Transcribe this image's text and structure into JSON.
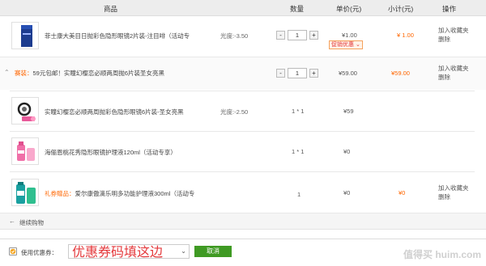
{
  "header": {
    "goods": "商品",
    "quantity": "数量",
    "unit_price": "单价(元)",
    "subtotal": "小计(元)",
    "operation": "操作"
  },
  "rows": [
    {
      "name": "菲士康大美目日抛彩色隐形眼镜2片装-注目啡（活动专",
      "spec": "光度:-3.50",
      "qty": "1",
      "price": "¥1.00",
      "promo": "促销优惠",
      "subtotal": "1.00",
      "op1": "加入收藏夹",
      "op2": "删除"
    }
  ],
  "bundle": {
    "tag": "赛装：",
    "title": "59元包邮！实瞳幻樱恋必顺两周抛6片装圣女亮黑",
    "qty": "1",
    "price": "¥59.00",
    "subtotal": "¥59.00",
    "op1": "加入收藏夹",
    "op2": "删除",
    "items": [
      {
        "name": "实瞳幻樱恋必顺两周抛彩色隐形眼镜6片装-圣女亮黑",
        "spec": "光度:-2.50",
        "qty": "1 * 1",
        "price": "¥59"
      },
      {
        "name": "海俪恩桃花秀隐形眼镜护理液120ml（活动专享）",
        "spec": "",
        "qty": "1 * 1",
        "price": "¥0"
      }
    ]
  },
  "gift": {
    "tag": "礼券赠品：",
    "name": "爱尔康傲滴乐明多功能护理液300ml（活动专",
    "qty": "1",
    "price": "¥0",
    "subtotal": "¥0",
    "op1": "加入收藏夹",
    "op2": "删除"
  },
  "continue_shopping": "继续购物",
  "coupon": {
    "label": "使用优惠券：",
    "hint": "优惠券码填这边",
    "cancel": "取消"
  },
  "watermark": "值得买 huim.com",
  "colors": {
    "accent_red": "#e4393c",
    "accent_orange": "#ff6600",
    "green": "#3f9a23"
  }
}
